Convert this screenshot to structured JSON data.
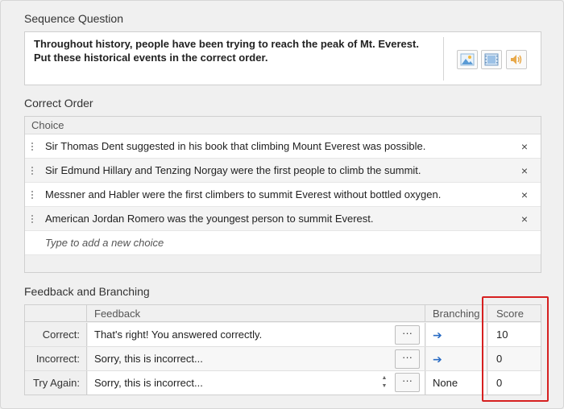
{
  "question_section": {
    "title": "Sequence Question",
    "text_line1": "Throughout history, people have been trying to reach the peak of Mt. Everest.",
    "text_line2": "Put these historical events in the correct order.",
    "media_icons": [
      "image-icon",
      "video-icon",
      "audio-icon"
    ]
  },
  "order_section": {
    "title": "Correct Order",
    "column_header": "Choice",
    "choices": [
      "Sir Thomas Dent suggested in his book that climbing Mount Everest was possible.",
      "Sir Edmund Hillary and Tenzing Norgay were the first people to climb the summit.",
      "Messner and Habler were the first climbers to summit Everest without bottled oxygen.",
      "American Jordan Romero was the youngest person to summit Everest."
    ],
    "remove_symbol": "×",
    "new_choice_placeholder": "Type to add a new choice"
  },
  "feedback_section": {
    "title": "Feedback and Branching",
    "headers": {
      "feedback": "Feedback",
      "branching": "Branching",
      "score": "Score"
    },
    "more_label": "···",
    "rows": [
      {
        "label": "Correct:",
        "feedback": "That's right! You answered correctly.",
        "branching": "➔",
        "score": "10"
      },
      {
        "label": "Incorrect:",
        "feedback": "Sorry, this is incorrect...",
        "branching": "➔",
        "score": "0"
      },
      {
        "label": "Try Again:",
        "feedback": "Sorry, this is incorrect...",
        "branching": "None",
        "score": "0"
      }
    ]
  },
  "colors": {
    "highlight": "#d62020",
    "arrow": "#2a6cc4"
  }
}
